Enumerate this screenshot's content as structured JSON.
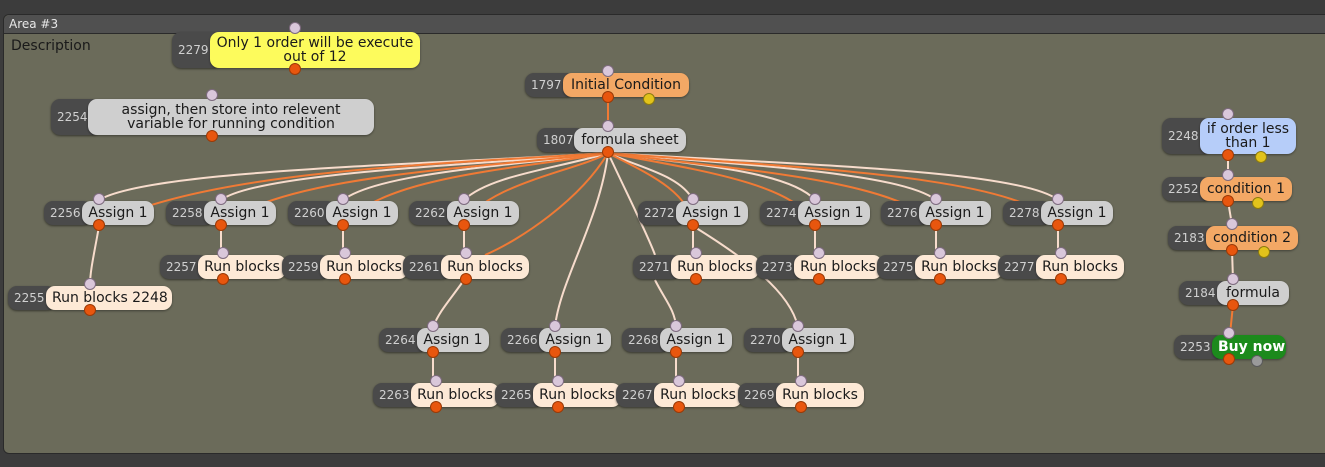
{
  "area": {
    "title": "Area #3",
    "description": "Description"
  },
  "nodes": {
    "n2279": {
      "id": "2279",
      "label": "Only 1 order will be execute out of 12"
    },
    "n2254": {
      "id": "2254",
      "label": "assign, then store into relevent variable for running condition"
    },
    "n1797": {
      "id": "1797",
      "label": "Initial Condition"
    },
    "n1807": {
      "id": "1807",
      "label": "formula sheet"
    },
    "n2256": {
      "id": "2256",
      "label": "Assign 1"
    },
    "n2258": {
      "id": "2258",
      "label": "Assign 1"
    },
    "n2260": {
      "id": "2260",
      "label": "Assign 1"
    },
    "n2262": {
      "id": "2262",
      "label": "Assign 1"
    },
    "n2272": {
      "id": "2272",
      "label": "Assign 1"
    },
    "n2274": {
      "id": "2274",
      "label": "Assign 1"
    },
    "n2276": {
      "id": "2276",
      "label": "Assign 1"
    },
    "n2278": {
      "id": "2278",
      "label": "Assign 1"
    },
    "n2255": {
      "id": "2255",
      "label": "Run blocks 2248"
    },
    "n2257": {
      "id": "2257",
      "label": "Run blocks"
    },
    "n2259": {
      "id": "2259",
      "label": "Run blocks"
    },
    "n2261": {
      "id": "2261",
      "label": "Run blocks"
    },
    "n2271": {
      "id": "2271",
      "label": "Run blocks"
    },
    "n2273": {
      "id": "2273",
      "label": "Run blocks"
    },
    "n2275": {
      "id": "2275",
      "label": "Run blocks"
    },
    "n2277": {
      "id": "2277",
      "label": "Run blocks"
    },
    "n2264": {
      "id": "2264",
      "label": "Assign 1"
    },
    "n2266": {
      "id": "2266",
      "label": "Assign 1"
    },
    "n2268": {
      "id": "2268",
      "label": "Assign 1"
    },
    "n2270": {
      "id": "2270",
      "label": "Assign 1"
    },
    "n2263": {
      "id": "2263",
      "label": "Run blocks"
    },
    "n2265": {
      "id": "2265",
      "label": "Run blocks"
    },
    "n2267": {
      "id": "2267",
      "label": "Run blocks"
    },
    "n2269": {
      "id": "2269",
      "label": "Run blocks"
    },
    "n2248": {
      "id": "2248",
      "label": "if order less than 1"
    },
    "n2252": {
      "id": "2252",
      "label": "condition 1"
    },
    "n2183": {
      "id": "2183",
      "label": "condition 2"
    },
    "n2184": {
      "id": "2184",
      "label": "formula"
    },
    "n2253": {
      "id": "2253",
      "label": "Buy now"
    }
  },
  "colors": {
    "canvas": "#6b6b5a",
    "id_tab": "#4a4a4a",
    "node_grey": "#cfcfcf",
    "node_cream": "#fde9d6",
    "node_orange": "#f3a865",
    "node_yellow": "#fdfb5c",
    "node_blue": "#b6cdf9",
    "node_green": "#1c8a1c",
    "wire_orange": "#f07a35",
    "wire_light": "#f7dccc"
  }
}
